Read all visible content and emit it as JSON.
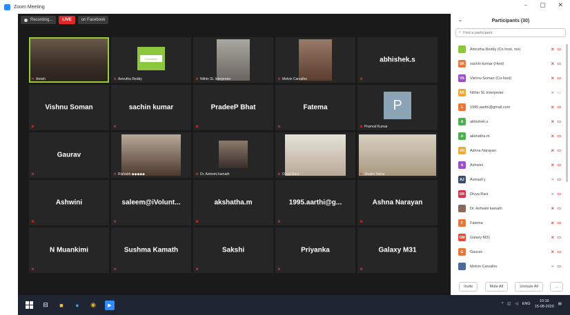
{
  "window": {
    "title": "Zoom Meeting",
    "minimize": "–",
    "maximize": "▢",
    "close": "✕"
  },
  "meeting": {
    "recording_label": "Recording...",
    "live_label": "LIVE",
    "facebook_label": "on Facebook"
  },
  "tiles": [
    {
      "name": "",
      "caption": "Amish",
      "type": "video",
      "photo": "p-amish",
      "active": true
    },
    {
      "name": "",
      "caption": "Amrutha Reddy",
      "type": "logo",
      "logo_text": "iVolunteer"
    },
    {
      "name": "",
      "caption": "Nithin SL Interpreter",
      "type": "video",
      "photo": "p-nithin"
    },
    {
      "name": "",
      "caption": "Melvin Carvalho",
      "type": "video",
      "photo": "p-melvin"
    },
    {
      "name": "abhishek.s",
      "caption": "",
      "type": "name"
    },
    {
      "name": "Vishnu Soman",
      "caption": "",
      "type": "name"
    },
    {
      "name": "sachin kumar",
      "caption": "",
      "type": "name"
    },
    {
      "name": "PradeeP Bhat",
      "caption": "",
      "type": "name"
    },
    {
      "name": "Fatema",
      "caption": "",
      "type": "name"
    },
    {
      "name": "",
      "caption": "Pramod Kumar",
      "type": "avatar",
      "letter": "P"
    },
    {
      "name": "Gaurav",
      "caption": "",
      "type": "name"
    },
    {
      "name": "",
      "caption": "Rishabh ◆◆◆◆◆",
      "type": "video",
      "photo": "p-rishab"
    },
    {
      "name": "",
      "caption": "Dr. Ashwini kamath",
      "type": "video",
      "photo": "p-ashwini-k"
    },
    {
      "name": "",
      "caption": "Divya Ravi",
      "type": "video",
      "photo": "p-divya"
    },
    {
      "name": "",
      "caption": "Shalini Sahar",
      "type": "video",
      "photo": "p-shalini"
    },
    {
      "name": "Ashwini",
      "caption": "",
      "type": "name"
    },
    {
      "name": "saleem@iVolunt...",
      "caption": "",
      "type": "name"
    },
    {
      "name": "akshatha.m",
      "caption": "",
      "type": "name"
    },
    {
      "name": "1995.aarthi@g...",
      "caption": "",
      "type": "name"
    },
    {
      "name": "Ashna Narayan",
      "caption": "",
      "type": "name"
    },
    {
      "name": "N Muankimi",
      "caption": "",
      "type": "name"
    },
    {
      "name": "Sushma Kamath",
      "caption": "",
      "type": "name"
    },
    {
      "name": "Sakshi",
      "caption": "",
      "type": "name"
    },
    {
      "name": "Priyanka",
      "caption": "",
      "type": "name"
    },
    {
      "name": "Galaxy M31",
      "caption": "",
      "type": "name"
    }
  ],
  "participants_panel": {
    "title": "Participants (30)",
    "search_placeholder": "Find a participant",
    "participants": [
      {
        "name": "Amrutha Reddy (Co-host, me)",
        "initials": "",
        "color": "#8dc63f",
        "video": "red",
        "mic": "red"
      },
      {
        "name": "sachin kumar (Host)",
        "initials": "SK",
        "color": "#e8773a",
        "video": "red",
        "mic": "red"
      },
      {
        "name": "Vishnu Soman (Co-host)",
        "initials": "VS",
        "color": "#9b4fc9",
        "video": "red",
        "mic": "red"
      },
      {
        "name": "Nithin SL Interpreter",
        "initials": "NS",
        "color": "#f0a830",
        "video": "grey",
        "mic": "grey"
      },
      {
        "name": "1995.aarthi@gmail.com",
        "initials": "1",
        "color": "#e8773a",
        "video": "red",
        "mic": "red"
      },
      {
        "name": "abhishek.s",
        "initials": "A",
        "color": "#4caf50",
        "video": "red",
        "mic": "red"
      },
      {
        "name": "akshatha.m",
        "initials": "A",
        "color": "#4caf50",
        "video": "red",
        "mic": "red"
      },
      {
        "name": "Ashna Narayan",
        "initials": "AN",
        "color": "#f0a830",
        "video": "red",
        "mic": "red"
      },
      {
        "name": "Ashwini",
        "initials": "A",
        "color": "#9b4fc9",
        "video": "red",
        "mic": "red"
      },
      {
        "name": "Avinash j",
        "initials": "AJ",
        "color": "#3b4f6b",
        "video": "red",
        "mic": "grey"
      },
      {
        "name": "Divya Ravi",
        "initials": "DR",
        "color": "#d8334a",
        "video": "red",
        "mic": "grey"
      },
      {
        "name": "Dr. Ashwini kamath",
        "initials": "",
        "color": "#8a6a5a",
        "video": "red",
        "mic": "red"
      },
      {
        "name": "Fatema",
        "initials": "F",
        "color": "#e8773a",
        "video": "red",
        "mic": "red"
      },
      {
        "name": "Galaxy M31",
        "initials": "GM",
        "color": "#e84a3a",
        "video": "red",
        "mic": "red"
      },
      {
        "name": "Gaurav",
        "initials": "G",
        "color": "#e8773a",
        "video": "red",
        "mic": "red"
      },
      {
        "name": "Melvin Carvalho",
        "initials": "",
        "color": "#4a6a9a",
        "video": "red",
        "mic": "grey"
      }
    ],
    "invite_label": "Invite",
    "mute_all_label": "Mute All",
    "unmute_all_label": "Unmute All",
    "more_label": "..."
  },
  "taskbar": {
    "language": "ENG",
    "time": "10:16",
    "date": "15-08-2020"
  }
}
